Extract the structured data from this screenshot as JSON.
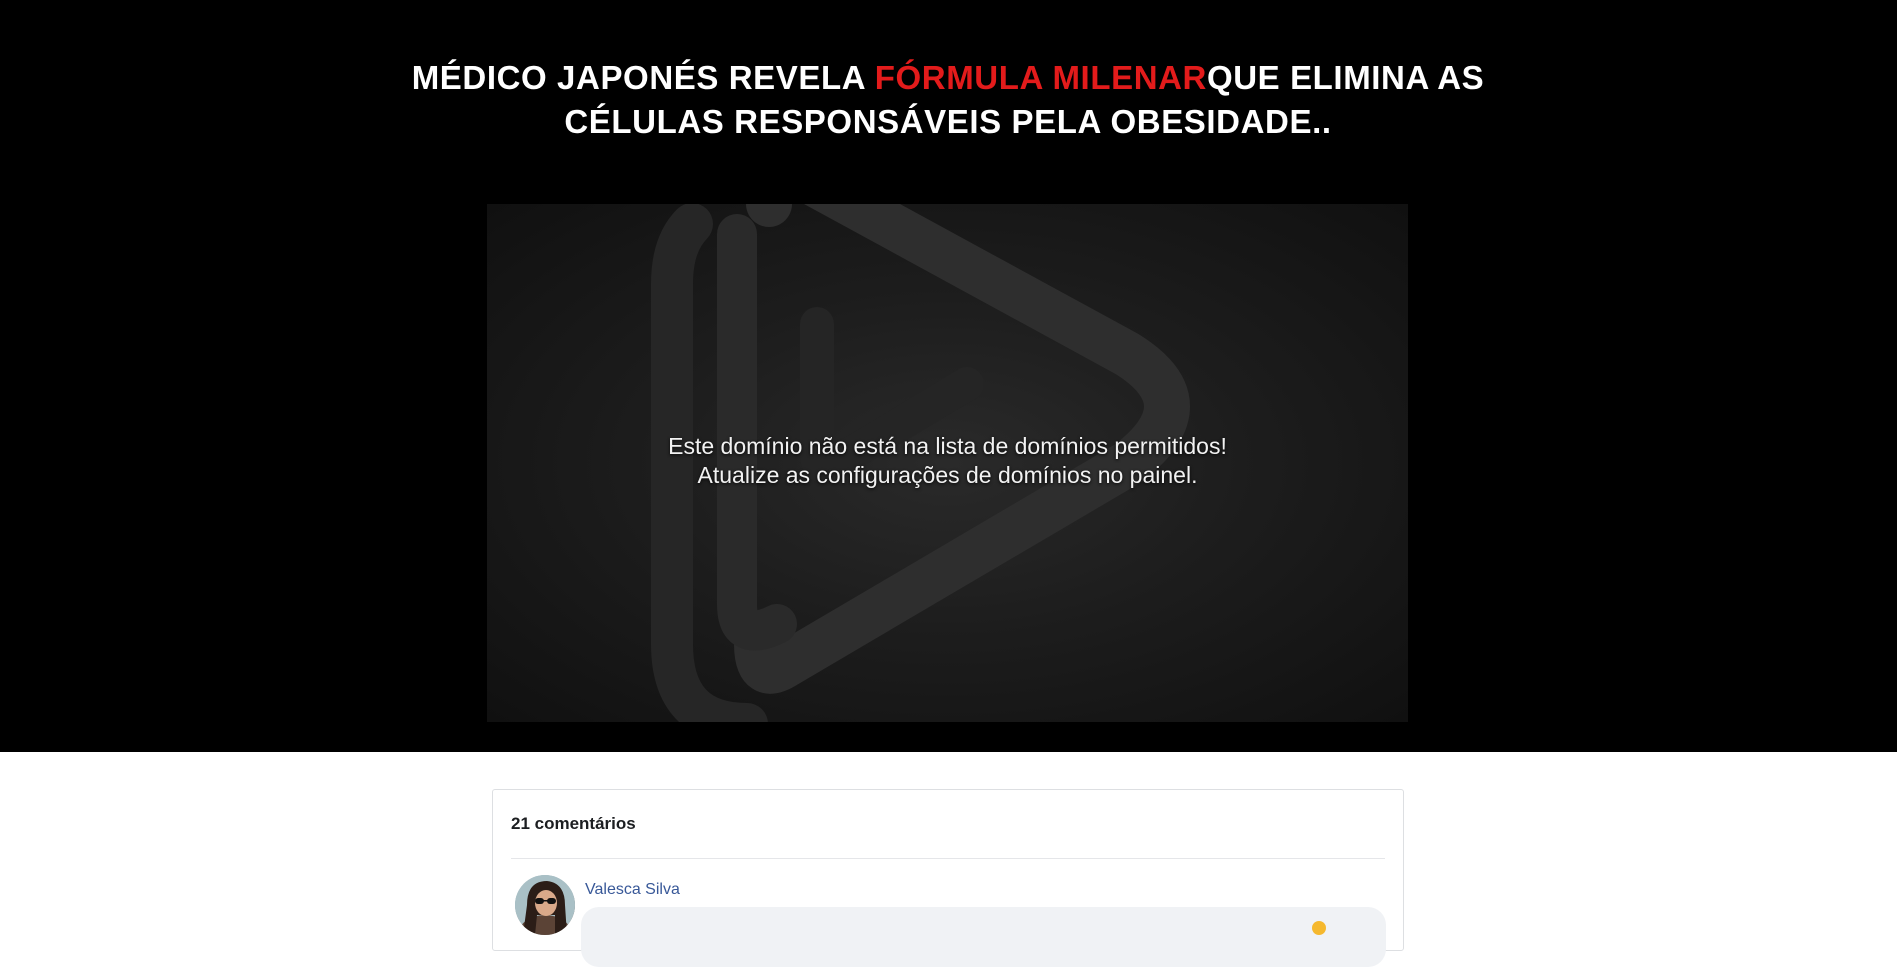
{
  "headline": {
    "part1": "MÉDICO JAPONÉS REVELA ",
    "accent": "FÓRMULA MILENAR",
    "part2": "QUE ELIMINA AS CÉLULAS RESPONSÁVEIS PELA OBESIDADE..",
    "accent_color": "#e31b1b"
  },
  "player": {
    "logo_icon": "play-logo-icon",
    "message_line1": "Este domínio não está na lista de domínios permitidos!",
    "message_line2": "Atualize as configurações de domínios no painel."
  },
  "comments": {
    "count_label": "21 comentários",
    "items": [
      {
        "name": "Valesca Silva",
        "avatar_icon": "avatar-photo"
      }
    ],
    "link_color": "#385898"
  }
}
